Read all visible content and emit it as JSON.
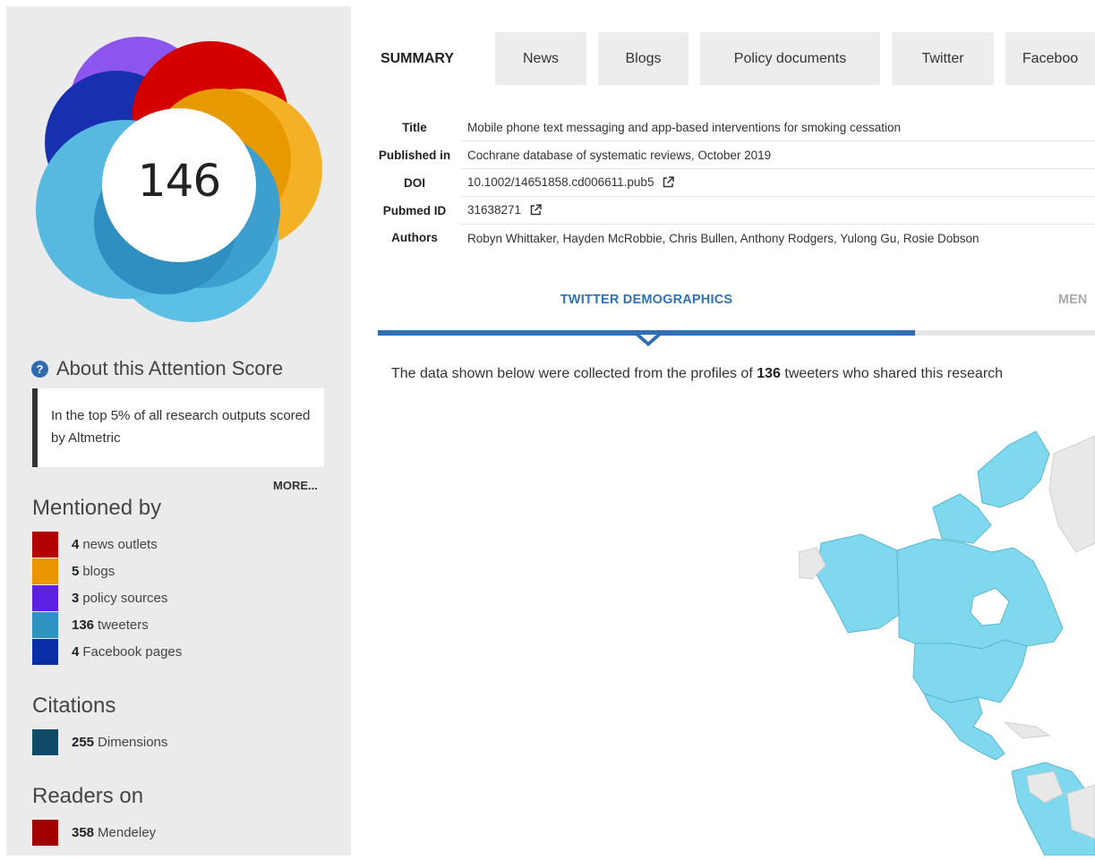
{
  "score": {
    "value": "146"
  },
  "about": {
    "label": "About this Attention Score",
    "rank_text": "In the top 5% of all research outputs scored by Altmetric",
    "more_label": "MORE..."
  },
  "mentioned_by": {
    "heading": "Mentioned by",
    "items": [
      {
        "count": "4",
        "label": "news outlets",
        "color": "#b00000"
      },
      {
        "count": "5",
        "label": "blogs",
        "color": "#e89500"
      },
      {
        "count": "3",
        "label": "policy sources",
        "color": "#5a21e0"
      },
      {
        "count": "136",
        "label": "tweeters",
        "color": "#2f93c1"
      },
      {
        "count": "4",
        "label": "Facebook pages",
        "color": "#0a2ea6"
      }
    ]
  },
  "citations": {
    "heading": "Citations",
    "items": [
      {
        "count": "255",
        "label": "Dimensions",
        "color": "#0f4a68"
      }
    ]
  },
  "readers": {
    "heading": "Readers on",
    "items": [
      {
        "count": "358",
        "label": "Mendeley",
        "color": "#a00000"
      }
    ]
  },
  "tabs": [
    {
      "label": "SUMMARY",
      "active": true
    },
    {
      "label": "News"
    },
    {
      "label": "Blogs"
    },
    {
      "label": "Policy documents"
    },
    {
      "label": "Twitter"
    },
    {
      "label": "Faceboo"
    }
  ],
  "summary": {
    "title_label": "Title",
    "title": "Mobile phone text messaging and app-based interventions for smoking cessation",
    "published_label": "Published in",
    "published": "Cochrane database of systematic reviews, October 2019",
    "doi_label": "DOI",
    "doi": "10.1002/14651858.cd006611.pub5",
    "pubmed_label": "Pubmed ID",
    "pubmed": "31638271",
    "authors_label": "Authors",
    "authors": "Robyn Whittaker, Hayden McRobbie, Chris Bullen, Anthony Rodgers, Yulong Gu, Rosie Dobson"
  },
  "demographics": {
    "twitter_tab": "TWITTER DEMOGRAPHICS",
    "mendeley_tab": "MEN",
    "collected_prefix": "The data shown below were collected from the profiles of",
    "collected_count": "136",
    "collected_suffix": "tweeters who shared this research"
  },
  "map_colors": {
    "highlight": "#7fd8ee",
    "border": "#5ab6d1",
    "other": "#e8e8e8"
  }
}
